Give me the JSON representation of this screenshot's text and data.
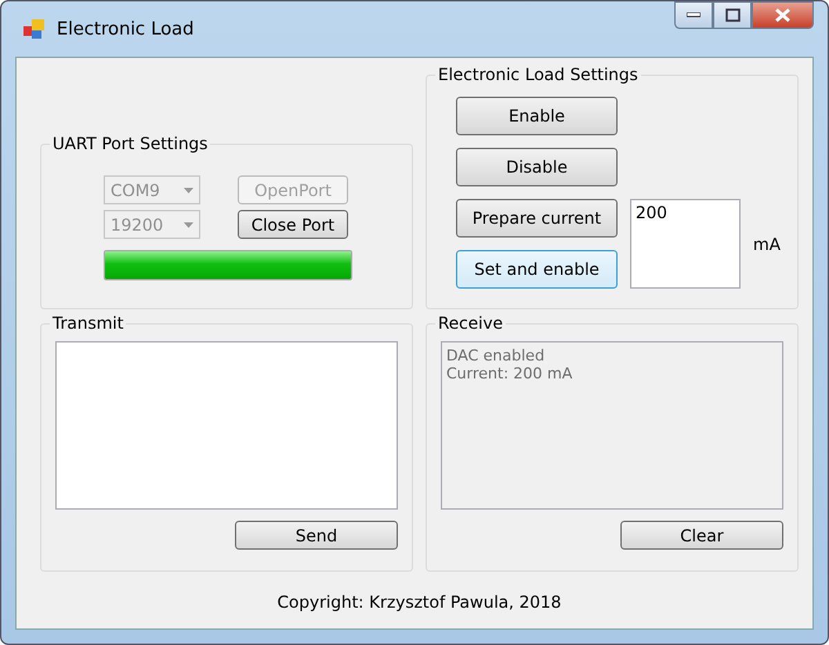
{
  "window": {
    "title": "Electronic Load"
  },
  "uart": {
    "title": "UART Port Settings",
    "port": {
      "value": "COM9",
      "disabled": true
    },
    "baud": {
      "value": "19200",
      "disabled": true
    },
    "buttons": [
      {
        "label": "OpenPort",
        "disabled": true
      },
      {
        "label": "Close Port",
        "disabled": false
      }
    ],
    "progress": {
      "level": 1
    }
  },
  "load": {
    "title": "Electronic Load Settings",
    "buttons": [
      {
        "label": "Enable",
        "focused": false
      },
      {
        "label": "Disable",
        "focused": false
      },
      {
        "label": "Prepare current",
        "focused": false
      },
      {
        "label": "Set and enable",
        "focused": true
      }
    ],
    "current": {
      "value": "200"
    },
    "unit": "mA"
  },
  "transmit": {
    "title": "Transmit",
    "button": "Send"
  },
  "receive": {
    "title": "Receive",
    "lines": [
      "DAC enabled",
      "Current: 200 mA"
    ],
    "button": "Clear"
  },
  "footer": "Copyright: Krzysztof Pawula, 2018"
}
